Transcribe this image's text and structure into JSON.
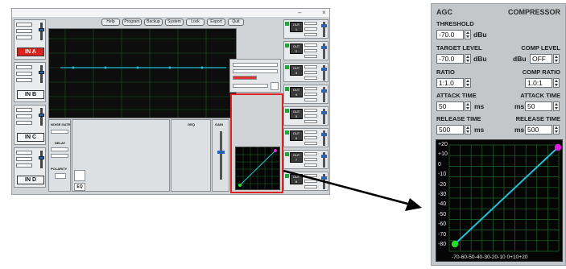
{
  "left_window": {
    "toolbar": [
      "Help",
      "Program",
      "Backup",
      "System",
      "Lock",
      "Export",
      "Quit"
    ],
    "inputs": [
      {
        "label": "IN A",
        "active": true
      },
      {
        "label": "IN B",
        "active": false
      },
      {
        "label": "IN C",
        "active": false
      },
      {
        "label": "IN D",
        "active": false
      }
    ],
    "outputs": [
      "1",
      "2",
      "3",
      "4",
      "5",
      "6",
      "7",
      "8"
    ],
    "out_label": "OUT",
    "noise_gate_label": "NOISE GATE",
    "delay_label": "DELAY",
    "polarity_label": "POLARITY",
    "geq_label": "GEQ",
    "eq_button": "EQ",
    "gain_label": "GAIN"
  },
  "agc": {
    "title": "AGC",
    "compressor_title": "COMPRESSOR",
    "threshold_label": "THRESHOLD",
    "threshold_value": "-70.0",
    "threshold_unit": "dBu",
    "target_level_label": "TARGET LEVEL",
    "target_level_value": "-70.0",
    "target_level_unit": "dBu",
    "comp_level_label": "COMP LEVEL",
    "comp_level_unit": "dBu",
    "comp_level_value": "OFF",
    "ratio_label": "RATIO",
    "ratio_value": "1:1.0",
    "comp_ratio_label": "COMP RATIO",
    "comp_ratio_value": "1.0:1",
    "attack_time_label": "ATTACK TIME",
    "attack_time_value": "50",
    "attack_unit": "ms",
    "comp_attack_time_label": "ATTACK TIME",
    "comp_attack_time_value": "50",
    "comp_attack_unit": "ms",
    "release_time_label": "RELEASE TIME",
    "release_time_value": "500",
    "release_unit": "ms",
    "comp_release_time_label": "RELEASE TIME",
    "comp_release_time_value": "500",
    "comp_release_unit": "ms",
    "graph": {
      "y_ticks": [
        "+20",
        "+10",
        "0",
        "-10",
        "-20",
        "-30",
        "-40",
        "-50",
        "-60",
        "-70",
        "-80"
      ],
      "x_ticks": "-70-60-50-40-30-20-10 0+10+20",
      "line_color": "#22c1d6",
      "start_marker_color": "#22dd22",
      "end_marker_color": "#e020e0",
      "grid_color": "#1f6b2a"
    }
  }
}
